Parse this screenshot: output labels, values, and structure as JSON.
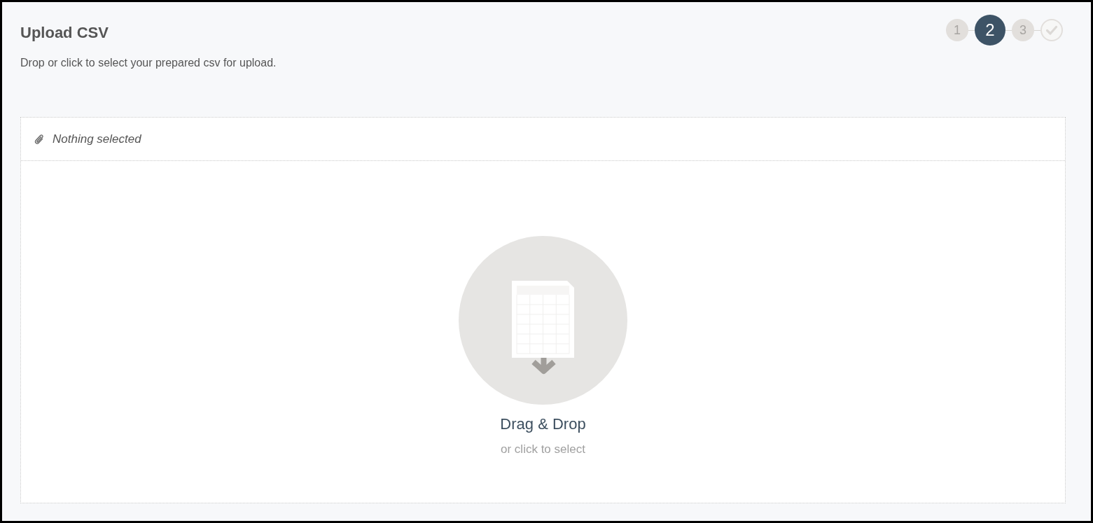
{
  "header": {
    "title": "Upload CSV",
    "subtitle": "Drop or click to select your prepared csv for upload."
  },
  "steps": [
    {
      "kind": "number",
      "label": "1",
      "selected": false
    },
    {
      "kind": "number",
      "label": "2",
      "selected": true
    },
    {
      "kind": "number",
      "label": "3",
      "selected": false
    },
    {
      "kind": "check",
      "selected": false
    }
  ],
  "drop_zone": {
    "selected_file": "Nothing selected",
    "prompt": "Drag & Drop",
    "hint": "or click to select"
  }
}
